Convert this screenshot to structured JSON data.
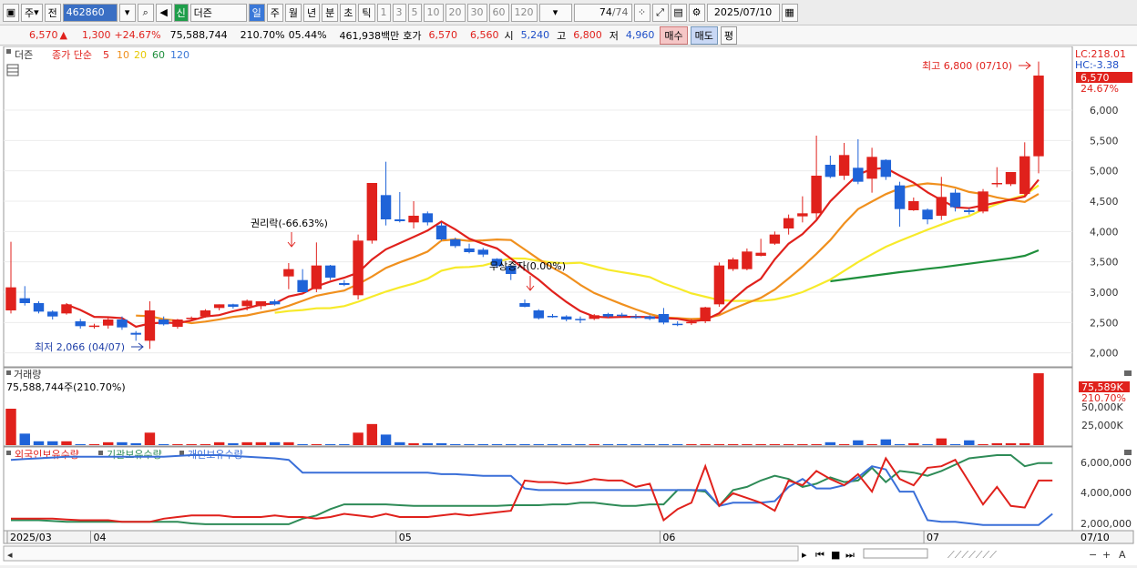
{
  "toolbar": {
    "period_label": "주",
    "prev_label": "전",
    "stock_code": "462860",
    "new_badge": "신",
    "stock_name": "더즌",
    "intervals": [
      "일",
      "주",
      "월",
      "년",
      "분",
      "초",
      "틱"
    ],
    "ranges": [
      "1",
      "3",
      "5",
      "10",
      "20",
      "30",
      "60",
      "120"
    ],
    "page_count": "74",
    "page_total": "/74",
    "date": "2025/07/10"
  },
  "info": {
    "price": "6,570",
    "change": "1,300",
    "change_pct": "+24.67%",
    "volume": "75,588,744",
    "volume_ratio": "210.70%",
    "turnover": "05.44%",
    "amount": "461,938백만",
    "quote_label": "호가",
    "ask": "6,570",
    "bid": "6,560",
    "open_label": "시",
    "open": "5,240",
    "high_label": "고",
    "high": "6,800",
    "low_label": "저",
    "low": "4,960",
    "buy_button": "매수",
    "sell_button": "매도",
    "eval_button": "평"
  },
  "legend": {
    "name": "더즌",
    "title": "종가 단순",
    "ma": [
      {
        "label": "5",
        "color": "#e0211c"
      },
      {
        "label": "10",
        "color": "#f0901e"
      },
      {
        "label": "20",
        "color": "#f2e22b"
      },
      {
        "label": "60",
        "color": "#1f8f3c"
      },
      {
        "label": "120",
        "color": "#3a78d8"
      }
    ]
  },
  "price_panel": {
    "lc": "LC:218.01",
    "hc": "HC:-3.38",
    "last_price": "6,570",
    "last_pct": "24.67%",
    "max_label": "최고 6,800 (07/10)",
    "min_label": "최저 2,066 (04/07)",
    "annotation_split": "권리락(-66.63%)",
    "annotation_free": "무상증자(0.00%)",
    "y_ticks": [
      "6,000",
      "5,500",
      "5,000",
      "4,500",
      "4,000",
      "3,500",
      "3,000",
      "2,500",
      "2,000"
    ]
  },
  "volume_panel": {
    "title": "거래량",
    "value_label": "75,588,744주(210.70%)",
    "last_volume": "75,589K",
    "last_ratio": "210.70%",
    "y_ticks": [
      "50,000K",
      "25,000K"
    ]
  },
  "holdings_panel": {
    "legend": [
      {
        "label": "외국인보유수량",
        "color": "#e0211c"
      },
      {
        "label": "기관보유수량",
        "color": "#2e8b57"
      },
      {
        "label": "개인보유수량",
        "color": "#3a6fd8"
      }
    ],
    "y_ticks": [
      "6,000,000",
      "4,000,000",
      "2,000,000"
    ]
  },
  "x_axis": {
    "labels": [
      {
        "label": "2025/03",
        "idx": 0
      },
      {
        "label": "04",
        "idx": 6
      },
      {
        "label": "05",
        "idx": 28
      },
      {
        "label": "06",
        "idx": 47
      },
      {
        "label": "07",
        "idx": 66
      }
    ],
    "last_label": "07/10"
  },
  "chart_data": {
    "type": "candlestick",
    "ylim": [
      1800,
      6900
    ],
    "candles": [
      {
        "o": 2700,
        "h": 3830,
        "l": 2650,
        "c": 3080
      },
      {
        "o": 2900,
        "h": 3100,
        "l": 2780,
        "c": 2820
      },
      {
        "o": 2820,
        "h": 2850,
        "l": 2650,
        "c": 2680
      },
      {
        "o": 2680,
        "h": 2700,
        "l": 2550,
        "c": 2600
      },
      {
        "o": 2650,
        "h": 2820,
        "l": 2630,
        "c": 2800
      },
      {
        "o": 2520,
        "h": 2560,
        "l": 2400,
        "c": 2440
      },
      {
        "o": 2440,
        "h": 2480,
        "l": 2400,
        "c": 2450
      },
      {
        "o": 2450,
        "h": 2580,
        "l": 2400,
        "c": 2550
      },
      {
        "o": 2550,
        "h": 2600,
        "l": 2380,
        "c": 2420
      },
      {
        "o": 2330,
        "h": 2360,
        "l": 2200,
        "c": 2300
      },
      {
        "o": 2200,
        "h": 2850,
        "l": 2066,
        "c": 2700
      },
      {
        "o": 2550,
        "h": 2600,
        "l": 2450,
        "c": 2470
      },
      {
        "o": 2430,
        "h": 2560,
        "l": 2400,
        "c": 2550
      },
      {
        "o": 2560,
        "h": 2600,
        "l": 2530,
        "c": 2580
      },
      {
        "o": 2600,
        "h": 2720,
        "l": 2580,
        "c": 2700
      },
      {
        "o": 2740,
        "h": 2800,
        "l": 2700,
        "c": 2800
      },
      {
        "o": 2800,
        "h": 2810,
        "l": 2730,
        "c": 2760
      },
      {
        "o": 2770,
        "h": 2880,
        "l": 2700,
        "c": 2860
      },
      {
        "o": 2770,
        "h": 2850,
        "l": 2720,
        "c": 2850
      },
      {
        "o": 2850,
        "h": 2880,
        "l": 2780,
        "c": 2800
      },
      {
        "o": 3260,
        "h": 3480,
        "l": 3050,
        "c": 3380
      },
      {
        "o": 3200,
        "h": 3380,
        "l": 3060,
        "c": 3000
      },
      {
        "o": 3050,
        "h": 3820,
        "l": 3000,
        "c": 3440
      },
      {
        "o": 3440,
        "h": 3450,
        "l": 3200,
        "c": 3240
      },
      {
        "o": 3150,
        "h": 3200,
        "l": 3100,
        "c": 3120
      },
      {
        "o": 2950,
        "h": 3950,
        "l": 2880,
        "c": 3850
      },
      {
        "o": 3850,
        "h": 4560,
        "l": 3800,
        "c": 4800
      },
      {
        "o": 4600,
        "h": 5150,
        "l": 4100,
        "c": 4200
      },
      {
        "o": 4200,
        "h": 4650,
        "l": 4150,
        "c": 4170
      },
      {
        "o": 4150,
        "h": 4500,
        "l": 4050,
        "c": 4260
      },
      {
        "o": 4300,
        "h": 4330,
        "l": 4100,
        "c": 4150
      },
      {
        "o": 4100,
        "h": 4150,
        "l": 3850,
        "c": 3870
      },
      {
        "o": 3870,
        "h": 3900,
        "l": 3730,
        "c": 3760
      },
      {
        "o": 3720,
        "h": 3800,
        "l": 3640,
        "c": 3660
      },
      {
        "o": 3700,
        "h": 3730,
        "l": 3580,
        "c": 3620
      },
      {
        "o": 3550,
        "h": 3560,
        "l": 3400,
        "c": 3430
      },
      {
        "o": 3430,
        "h": 3460,
        "l": 3200,
        "c": 3300
      },
      {
        "o": 2820,
        "h": 2880,
        "l": 2750,
        "c": 2760
      },
      {
        "o": 2700,
        "h": 2720,
        "l": 2550,
        "c": 2570
      },
      {
        "o": 2610,
        "h": 2640,
        "l": 2580,
        "c": 2600
      },
      {
        "o": 2600,
        "h": 2620,
        "l": 2520,
        "c": 2550
      },
      {
        "o": 2560,
        "h": 2600,
        "l": 2490,
        "c": 2540
      },
      {
        "o": 2560,
        "h": 2640,
        "l": 2540,
        "c": 2620
      },
      {
        "o": 2640,
        "h": 2660,
        "l": 2580,
        "c": 2600
      },
      {
        "o": 2630,
        "h": 2660,
        "l": 2590,
        "c": 2620
      },
      {
        "o": 2600,
        "h": 2640,
        "l": 2560,
        "c": 2580
      },
      {
        "o": 2600,
        "h": 2620,
        "l": 2540,
        "c": 2560
      },
      {
        "o": 2640,
        "h": 2740,
        "l": 2470,
        "c": 2500
      },
      {
        "o": 2480,
        "h": 2520,
        "l": 2440,
        "c": 2470
      },
      {
        "o": 2490,
        "h": 2560,
        "l": 2460,
        "c": 2510
      },
      {
        "o": 2520,
        "h": 2760,
        "l": 2490,
        "c": 2750
      },
      {
        "o": 2800,
        "h": 3490,
        "l": 2760,
        "c": 3440
      },
      {
        "o": 3380,
        "h": 3570,
        "l": 3350,
        "c": 3540
      },
      {
        "o": 3380,
        "h": 3720,
        "l": 3360,
        "c": 3670
      },
      {
        "o": 3600,
        "h": 3880,
        "l": 3590,
        "c": 3650
      },
      {
        "o": 3800,
        "h": 4000,
        "l": 3780,
        "c": 3950
      },
      {
        "o": 4050,
        "h": 4280,
        "l": 3950,
        "c": 4220
      },
      {
        "o": 4250,
        "h": 4580,
        "l": 4150,
        "c": 4300
      },
      {
        "o": 4300,
        "h": 5580,
        "l": 4200,
        "c": 4920
      },
      {
        "o": 5100,
        "h": 5250,
        "l": 4880,
        "c": 4900
      },
      {
        "o": 4920,
        "h": 5460,
        "l": 4850,
        "c": 5260
      },
      {
        "o": 5050,
        "h": 5520,
        "l": 4780,
        "c": 4820
      },
      {
        "o": 4870,
        "h": 5380,
        "l": 4640,
        "c": 5230
      },
      {
        "o": 5180,
        "h": 5190,
        "l": 4850,
        "c": 4900
      },
      {
        "o": 4760,
        "h": 4820,
        "l": 4080,
        "c": 4370
      },
      {
        "o": 4350,
        "h": 4560,
        "l": 4340,
        "c": 4500
      },
      {
        "o": 4360,
        "h": 4380,
        "l": 4120,
        "c": 4200
      },
      {
        "o": 4260,
        "h": 4900,
        "l": 4190,
        "c": 4570
      },
      {
        "o": 4640,
        "h": 4700,
        "l": 4330,
        "c": 4400
      },
      {
        "o": 4350,
        "h": 4380,
        "l": 4280,
        "c": 4320
      },
      {
        "o": 4330,
        "h": 4700,
        "l": 4300,
        "c": 4660
      },
      {
        "o": 4780,
        "h": 5060,
        "l": 4730,
        "c": 4800
      },
      {
        "o": 4780,
        "h": 4980,
        "l": 4750,
        "c": 4980
      },
      {
        "o": 4620,
        "h": 5470,
        "l": 4590,
        "c": 5240
      },
      {
        "o": 5240,
        "h": 6800,
        "l": 4960,
        "c": 6570
      }
    ],
    "volume": [
      38,
      12,
      4,
      4,
      4,
      1,
      1,
      3,
      3,
      2,
      13,
      1,
      1,
      1,
      1,
      3,
      2,
      3,
      3,
      3,
      3,
      1,
      1,
      1,
      1,
      13,
      22,
      11,
      3,
      2,
      2,
      2,
      1,
      1,
      1,
      1,
      1,
      1,
      1,
      1,
      1,
      1,
      1,
      1,
      1,
      1,
      1,
      1,
      1,
      1,
      1,
      1,
      1,
      1,
      1,
      1,
      1,
      1,
      1,
      3,
      1,
      5,
      1,
      6,
      1,
      2,
      1,
      7,
      1,
      5,
      1,
      2,
      2,
      2,
      75
    ],
    "ma5": [
      null,
      null,
      null,
      null,
      2796,
      2708,
      2594,
      2588,
      2572,
      2432,
      2484,
      2500,
      2490,
      2534,
      2600,
      2622,
      2686,
      2738,
      2796,
      2814,
      2930,
      2978,
      3096,
      3176,
      3238,
      3322,
      3538,
      3706,
      3808,
      3910,
      4016,
      4164,
      4034,
      3882,
      3798,
      3722,
      3554,
      3374,
      3206,
      3010,
      2840,
      2688,
      2598,
      2584,
      2594,
      2594,
      2590,
      2572,
      2562,
      2522,
      2544,
      2654,
      2882,
      3078,
      3220,
      3542,
      3800,
      3958,
      4186,
      4498,
      4724,
      4940,
      5030,
      5046,
      4920,
      4804,
      4646,
      4516,
      4400,
      4384,
      4430,
      4478,
      4524,
      4576,
      4854
    ],
    "ma10": [
      null,
      null,
      null,
      null,
      null,
      null,
      null,
      null,
      null,
      2614,
      2604,
      2554,
      2530,
      2490,
      2516,
      2552,
      2594,
      2617,
      2666,
      2708,
      2776,
      2857,
      2941,
      2986,
      3027,
      3134,
      3258,
      3401,
      3492,
      3574,
      3669,
      3851,
      3870,
      3845,
      3854,
      3869,
      3859,
      3704,
      3544,
      3404,
      3281,
      3121,
      2986,
      2894,
      2802,
      2717,
      2639,
      2585,
      2573,
      2558,
      2569,
      2622,
      2727,
      2820,
      2907,
      3043,
      3227,
      3420,
      3632,
      3859,
      4133,
      4370,
      4494,
      4616,
      4709,
      4764,
      4793,
      4773,
      4723,
      4652,
      4617,
      4562,
      4520,
      4488,
      4619
    ],
    "ma20": [
      null,
      null,
      null,
      null,
      null,
      null,
      null,
      null,
      null,
      null,
      null,
      null,
      null,
      null,
      null,
      null,
      null,
      null,
      null,
      2661,
      2690,
      2706,
      2735,
      2738,
      2771,
      2843,
      2926,
      3009,
      3079,
      3141,
      3222,
      3354,
      3406,
      3416,
      3440,
      3501,
      3558,
      3553,
      3518,
      3489,
      3475,
      3486,
      3428,
      3369,
      3328,
      3293,
      3249,
      3144,
      3066,
      2981,
      2925,
      2871,
      2856,
      2857,
      2854,
      2880,
      2933,
      3002,
      3103,
      3208,
      3351,
      3496,
      3625,
      3748,
      3846,
      3938,
      4029,
      4115,
      4197,
      4255,
      4363,
      4452,
      4535,
      4601,
      4759
    ],
    "ma60": [
      null,
      null,
      null,
      null,
      null,
      null,
      null,
      null,
      null,
      null,
      null,
      null,
      null,
      null,
      null,
      null,
      null,
      null,
      null,
      null,
      null,
      null,
      null,
      null,
      null,
      null,
      null,
      null,
      null,
      null,
      null,
      null,
      null,
      null,
      null,
      null,
      null,
      null,
      null,
      null,
      null,
      null,
      null,
      null,
      null,
      null,
      null,
      null,
      null,
      null,
      null,
      null,
      null,
      null,
      null,
      null,
      null,
      null,
      null,
      3180,
      3210,
      3240,
      3270,
      3300,
      3330,
      3355,
      3385,
      3410,
      3440,
      3470,
      3500,
      3530,
      3560,
      3600,
      3690
    ],
    "foreign": [
      2200000,
      2200000,
      2200000,
      2200000,
      2150000,
      2100000,
      2100000,
      2100000,
      2000000,
      2000000,
      2000000,
      2200000,
      2300000,
      2400000,
      2400000,
      2400000,
      2300000,
      2300000,
      2300000,
      2400000,
      2300000,
      2300000,
      2200000,
      2300000,
      2500000,
      2400000,
      2300000,
      2500000,
      2300000,
      2300000,
      2300000,
      2400000,
      2500000,
      2400000,
      2500000,
      2600000,
      2700000,
      4600000,
      4500000,
      4500000,
      4400000,
      4500000,
      4700000,
      4600000,
      4600000,
      4200000,
      4400000,
      2100000,
      2800000,
      3200000,
      5500000,
      3000000,
      3800000,
      3500000,
      3200000,
      2700000,
      4600000,
      4300000,
      5200000,
      4700000,
      4300000,
      5000000,
      3900000,
      6000000,
      4700000,
      4300000,
      5400000,
      5500000,
      5900000,
      4500000,
      3100000,
      4200000,
      3000000,
      2900000,
      4600000,
      4600000
    ],
    "institution": [
      2100000,
      2100000,
      2100000,
      2050000,
      2000000,
      2000000,
      2000000,
      2000000,
      2000000,
      2000000,
      2000000,
      2000000,
      2000000,
      1900000,
      1850000,
      1850000,
      1850000,
      1850000,
      1850000,
      1850000,
      1850000,
      2200000,
      2400000,
      2800000,
      3100000,
      3100000,
      3100000,
      3100000,
      3050000,
      3000000,
      3000000,
      3000000,
      3000000,
      3000000,
      3000000,
      3000000,
      3050000,
      3050000,
      3050000,
      3100000,
      3100000,
      3200000,
      3200000,
      3100000,
      3000000,
      3000000,
      3100000,
      3100000,
      4000000,
      4000000,
      3900000,
      3000000,
      4000000,
      4200000,
      4600000,
      4900000,
      4700000,
      4200000,
      4400000,
      4800000,
      4500000,
      4600000,
      5400000,
      4500000,
      5200000,
      5100000,
      4900000,
      5200000,
      5600000,
      6000000,
      6100000,
      6200000,
      6200000,
      5500000,
      5700000,
      5700000
    ],
    "individual": [
      5900000,
      5950000,
      6000000,
      6050000,
      6100000,
      6100000,
      6100000,
      6100000,
      6100000,
      6100000,
      6100000,
      6100000,
      6150000,
      6200000,
      6200000,
      6200000,
      6150000,
      6100000,
      6050000,
      6000000,
      5900000,
      5100000,
      5100000,
      5100000,
      5100000,
      5100000,
      5100000,
      5100000,
      5100000,
      5100000,
      5100000,
      5000000,
      5000000,
      4950000,
      4900000,
      4900000,
      4900000,
      4100000,
      4000000,
      4000000,
      4000000,
      4000000,
      4000000,
      4000000,
      4000000,
      4000000,
      4000000,
      4000000,
      4000000,
      4000000,
      4000000,
      3000000,
      3200000,
      3200000,
      3200000,
      3300000,
      4200000,
      4700000,
      4100000,
      4100000,
      4300000,
      4800000,
      5500000,
      5300000,
      3900000,
      3900000,
      2100000,
      2000000,
      2000000,
      1900000,
      1800000,
      1800000,
      1800000,
      1800000,
      1800000,
      2500000
    ]
  }
}
